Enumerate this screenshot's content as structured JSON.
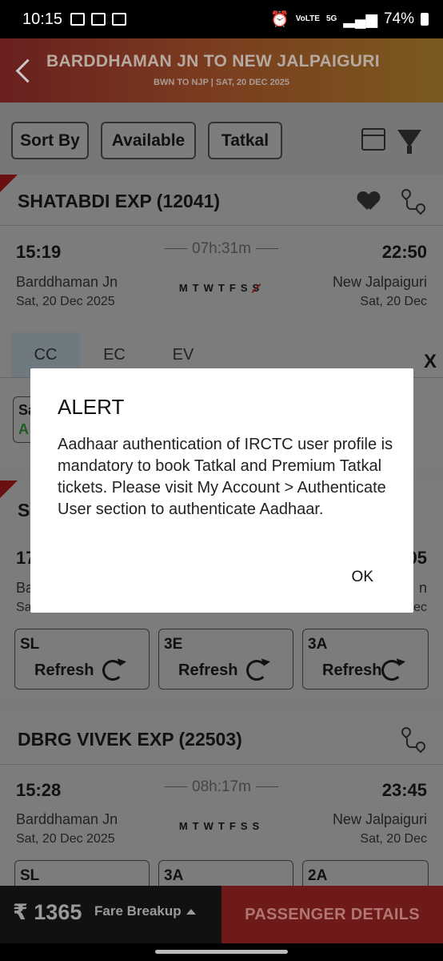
{
  "status_bar": {
    "time": "10:15",
    "battery": "74%",
    "network": "5G",
    "volte": "VoLTE"
  },
  "header": {
    "title": "BARDDHAMAN JN TO NEW JALPAIGURI",
    "subtitle": "BWN TO NJP | SAT, 20 DEC  2025"
  },
  "filters": {
    "sort_by": "Sort By",
    "available": "Available",
    "tatkal": "Tatkal"
  },
  "trains": [
    {
      "name": "SHATABDI EXP (12041)",
      "dep_time": "15:19",
      "arr_time": "22:50",
      "duration": "07h:31m",
      "from": "Barddhaman Jn",
      "to": "New Jalpaiguri",
      "from_date": "Sat, 20 Dec  2025",
      "to_date": "Sat, 20 Dec",
      "days": [
        "M",
        "T",
        "W",
        "T",
        "F",
        "S",
        "S"
      ],
      "classes": [
        "CC",
        "EC",
        "EV"
      ],
      "close": "X",
      "partial": {
        "s1": "Sa",
        "s2": "A"
      }
    },
    {
      "name": "S",
      "dep_time": "17",
      "arr_time": "05",
      "from": "Ba",
      "to": "n",
      "from_date": "Sa",
      "to_date": "ec",
      "boxes": [
        {
          "cls": "SL",
          "label": "Refresh"
        },
        {
          "cls": "3E",
          "label": "Refresh"
        },
        {
          "cls": "3A",
          "label": "Refresh"
        }
      ]
    },
    {
      "name": "DBRG VIVEK EXP (22503)",
      "dep_time": "15:28",
      "arr_time": "23:45",
      "duration": "08h:17m",
      "from": "Barddhaman Jn",
      "to": "New Jalpaiguri",
      "from_date": "Sat, 20 Dec  2025",
      "to_date": "Sat, 20 Dec",
      "days": [
        "M",
        "T",
        "W",
        "T",
        "F",
        "S",
        "S"
      ],
      "boxes": [
        {
          "cls": "SL"
        },
        {
          "cls": "3A"
        },
        {
          "cls": "2A"
        }
      ]
    }
  ],
  "bottom": {
    "fare": "₹ 1365",
    "fare_breakup": "Fare Breakup",
    "passenger_details": "PASSENGER DETAILS"
  },
  "dialog": {
    "title": "ALERT",
    "message": "Aadhaar authentication of IRCTC user profile is mandatory to book Tatkal and Premium Tatkal tickets. Please visit My Account > Authenticate User section to authenticate Aadhaar.",
    "ok": "OK"
  }
}
